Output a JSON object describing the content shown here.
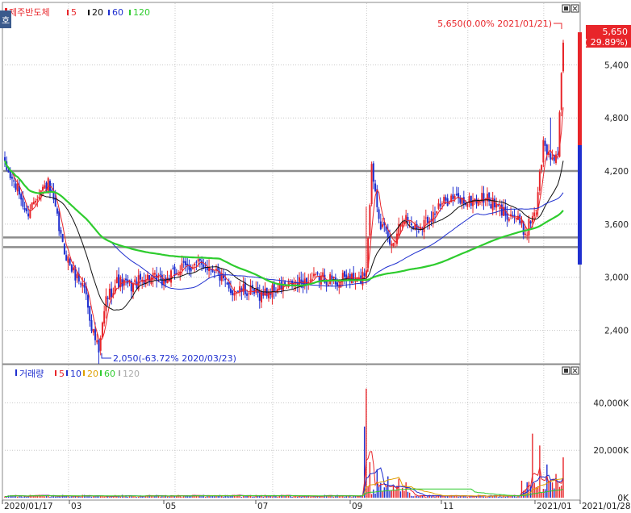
{
  "chart_data": [
    {
      "type": "candlestick",
      "title": "제주반도체",
      "legend": [
        {
          "label": "5",
          "color": "#e8252a"
        },
        {
          "label": "20",
          "color": "#111111"
        },
        {
          "label": "60",
          "color": "#1f2fcf"
        },
        {
          "label": "120",
          "color": "#2ecc2e"
        }
      ],
      "price_levels": [
        4200,
        3450,
        3340
      ],
      "ylim": [
        2050,
        5950
      ],
      "y_ticks": [
        "5,400",
        "4,800",
        "4,200",
        "3,600",
        "3,000",
        "2,400"
      ],
      "last_price": {
        "value": 5650,
        "text_top": "5,650",
        "text_bottom": "( 29.89%)"
      },
      "annotations": {
        "high": "5,650(0.00% 2021/01/21)",
        "low": "2,050(-63.72% 2020/03/23)"
      },
      "daily_close_anchors": [
        {
          "t": 0,
          "v": 4250
        },
        {
          "t": 8,
          "v": 3950
        },
        {
          "t": 12,
          "v": 3700
        },
        {
          "t": 18,
          "v": 3950
        },
        {
          "t": 24,
          "v": 4050
        },
        {
          "t": 28,
          "v": 3750
        },
        {
          "t": 32,
          "v": 3350
        },
        {
          "t": 38,
          "v": 3050
        },
        {
          "t": 44,
          "v": 2900
        },
        {
          "t": 48,
          "v": 2450
        },
        {
          "t": 52,
          "v": 2150
        },
        {
          "t": 56,
          "v": 2750
        },
        {
          "t": 62,
          "v": 2950
        },
        {
          "t": 70,
          "v": 2900
        },
        {
          "t": 78,
          "v": 3000
        },
        {
          "t": 88,
          "v": 2950
        },
        {
          "t": 98,
          "v": 3100
        },
        {
          "t": 108,
          "v": 3150
        },
        {
          "t": 116,
          "v": 3100
        },
        {
          "t": 124,
          "v": 2850
        },
        {
          "t": 132,
          "v": 2850
        },
        {
          "t": 140,
          "v": 2800
        },
        {
          "t": 148,
          "v": 2850
        },
        {
          "t": 156,
          "v": 2900
        },
        {
          "t": 166,
          "v": 2950
        },
        {
          "t": 176,
          "v": 3000
        },
        {
          "t": 184,
          "v": 2950
        },
        {
          "t": 190,
          "v": 3000
        },
        {
          "t": 196,
          "v": 2950
        },
        {
          "t": 200,
          "v": 3100
        },
        {
          "t": 203,
          "v": 4250
        },
        {
          "t": 208,
          "v": 3600
        },
        {
          "t": 214,
          "v": 3350
        },
        {
          "t": 220,
          "v": 3700
        },
        {
          "t": 228,
          "v": 3550
        },
        {
          "t": 236,
          "v": 3700
        },
        {
          "t": 246,
          "v": 3900
        },
        {
          "t": 256,
          "v": 3850
        },
        {
          "t": 266,
          "v": 3900
        },
        {
          "t": 274,
          "v": 3750
        },
        {
          "t": 282,
          "v": 3700
        },
        {
          "t": 288,
          "v": 3500
        },
        {
          "t": 294,
          "v": 3800
        },
        {
          "t": 298,
          "v": 4500
        },
        {
          "t": 302,
          "v": 4350
        },
        {
          "t": 306,
          "v": 4400
        },
        {
          "t": 309,
          "v": 5650
        }
      ],
      "x_labels": [
        "2020/01/17",
        "03",
        "05",
        "07",
        "09",
        "11",
        "2021/01",
        "2021/01/28"
      ]
    },
    {
      "type": "bar",
      "title": "거래량",
      "legend": [
        {
          "label": "5",
          "color": "#e8252a"
        },
        {
          "label": "10",
          "color": "#1f2fcf"
        },
        {
          "label": "20",
          "color": "#e0a000"
        },
        {
          "label": "60",
          "color": "#2ecc2e"
        },
        {
          "label": "120",
          "color": "#aaaaaa"
        }
      ],
      "ylim": [
        0,
        50000
      ],
      "y_ticks": [
        "40,000K",
        "20,000K",
        "0K"
      ],
      "volume_spikes": [
        {
          "t": 200,
          "v": 46000
        },
        {
          "t": 199,
          "v": 30000
        },
        {
          "t": 202,
          "v": 15000
        },
        {
          "t": 206,
          "v": 12000
        },
        {
          "t": 212,
          "v": 9000
        },
        {
          "t": 218,
          "v": 8000
        },
        {
          "t": 292,
          "v": 27000
        },
        {
          "t": 296,
          "v": 22000
        },
        {
          "t": 300,
          "v": 14000
        },
        {
          "t": 305,
          "v": 10000
        },
        {
          "t": 309,
          "v": 17000
        }
      ]
    }
  ],
  "ui": {
    "side_badge": "호"
  }
}
